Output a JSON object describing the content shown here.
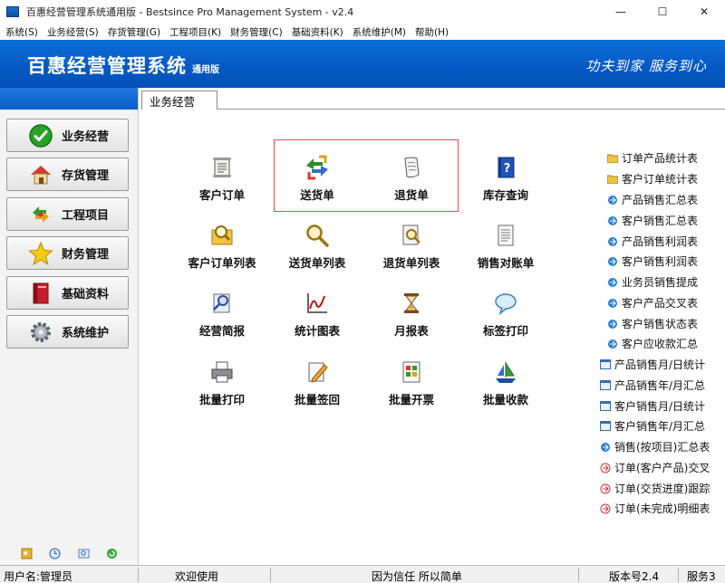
{
  "window": {
    "title": "百惠经营管理系统通用版 - Bestsince Pro Management System - v2.4",
    "controls": [
      "—",
      "☐",
      "✕"
    ]
  },
  "menu": [
    "系统(S)",
    "业务经营(S)",
    "存货管理(G)",
    "工程项目(K)",
    "财务管理(C)",
    "基础资料(K)",
    "系统维护(M)",
    "帮助(H)"
  ],
  "banner": {
    "title": "百惠经营管理系统",
    "edition": "通用版",
    "slogan": "功夫到家  服务到心"
  },
  "sidebar": {
    "items": [
      {
        "label": "业务经营",
        "icon": "check-circle-icon"
      },
      {
        "label": "存货管理",
        "icon": "house-icon"
      },
      {
        "label": "工程项目",
        "icon": "recycle-arrows-icon"
      },
      {
        "label": "财务管理",
        "icon": "star-icon"
      },
      {
        "label": "基础资料",
        "icon": "red-book-icon"
      },
      {
        "label": "系统维护",
        "icon": "gear-icon"
      }
    ],
    "footer_icons": [
      "key-icon",
      "clock-icon",
      "magnifier-icon",
      "green-refresh-icon"
    ]
  },
  "main": {
    "tab": "业务经营",
    "grid": [
      {
        "label": "客户订单",
        "icon": "scroll-document-icon"
      },
      {
        "label": "送货单",
        "icon": "delivery-arrows-icon"
      },
      {
        "label": "退货单",
        "icon": "return-document-icon"
      },
      {
        "label": "库存查询",
        "icon": "help-book-icon"
      },
      {
        "label": "客户订单列表",
        "icon": "search-folder-icon"
      },
      {
        "label": "送货单列表",
        "icon": "magnifier-icon"
      },
      {
        "label": "退货单列表",
        "icon": "search-page-icon"
      },
      {
        "label": "销售对账单",
        "icon": "list-document-icon"
      },
      {
        "label": "经营简报",
        "icon": "report-search-icon"
      },
      {
        "label": "统计图表",
        "icon": "line-chart-icon"
      },
      {
        "label": "月报表",
        "icon": "hourglass-icon"
      },
      {
        "label": "标签打印",
        "icon": "speech-bubble-icon"
      },
      {
        "label": "批量打印",
        "icon": "printer-icon"
      },
      {
        "label": "批量签回",
        "icon": "pencil-document-icon"
      },
      {
        "label": "批量开票",
        "icon": "invoice-icon"
      },
      {
        "label": "批量收款",
        "icon": "ship-icon"
      }
    ],
    "reports": [
      {
        "label": "订单产品统计表",
        "icon": "folder-icon"
      },
      {
        "label": "客户订单统计表",
        "icon": "folder-icon"
      },
      {
        "label": "产品销售汇总表",
        "icon": "report-arrow-icon"
      },
      {
        "label": "客户销售汇总表",
        "icon": "report-arrow-icon"
      },
      {
        "label": "产品销售利润表",
        "icon": "report-arrow-icon"
      },
      {
        "label": "客户销售利润表",
        "icon": "report-arrow-icon"
      },
      {
        "label": "业务员销售提成",
        "icon": "report-arrow-icon"
      },
      {
        "label": "客户产品交叉表",
        "icon": "report-arrow-icon"
      },
      {
        "label": "客户销售状态表",
        "icon": "report-arrow-icon"
      },
      {
        "label": "客户应收款汇总",
        "icon": "report-arrow-icon"
      },
      {
        "label": "产品销售月/日统计",
        "icon": "window-report-icon"
      },
      {
        "label": "产品销售年/月汇总",
        "icon": "window-report-icon"
      },
      {
        "label": "客户销售月/日统计",
        "icon": "window-report-icon"
      },
      {
        "label": "客户销售年/月汇总",
        "icon": "window-report-icon"
      },
      {
        "label": "销售(按项目)汇总表",
        "icon": "report-arrow-icon"
      },
      {
        "label": "订单(客户产品)交叉",
        "icon": "red-report-icon"
      },
      {
        "label": "订单(交货进度)跟踪",
        "icon": "red-report-icon"
      },
      {
        "label": "订单(未完成)明细表",
        "icon": "red-report-icon"
      }
    ]
  },
  "status": {
    "user": "用户名:管理员",
    "welcome": "欢迎使用",
    "motto": "因为信任 所以简单",
    "version": "版本号2.4",
    "service": "服务3"
  },
  "colors": {
    "banner_blue": "#0458c4",
    "highlight_red": "#d9534f"
  }
}
